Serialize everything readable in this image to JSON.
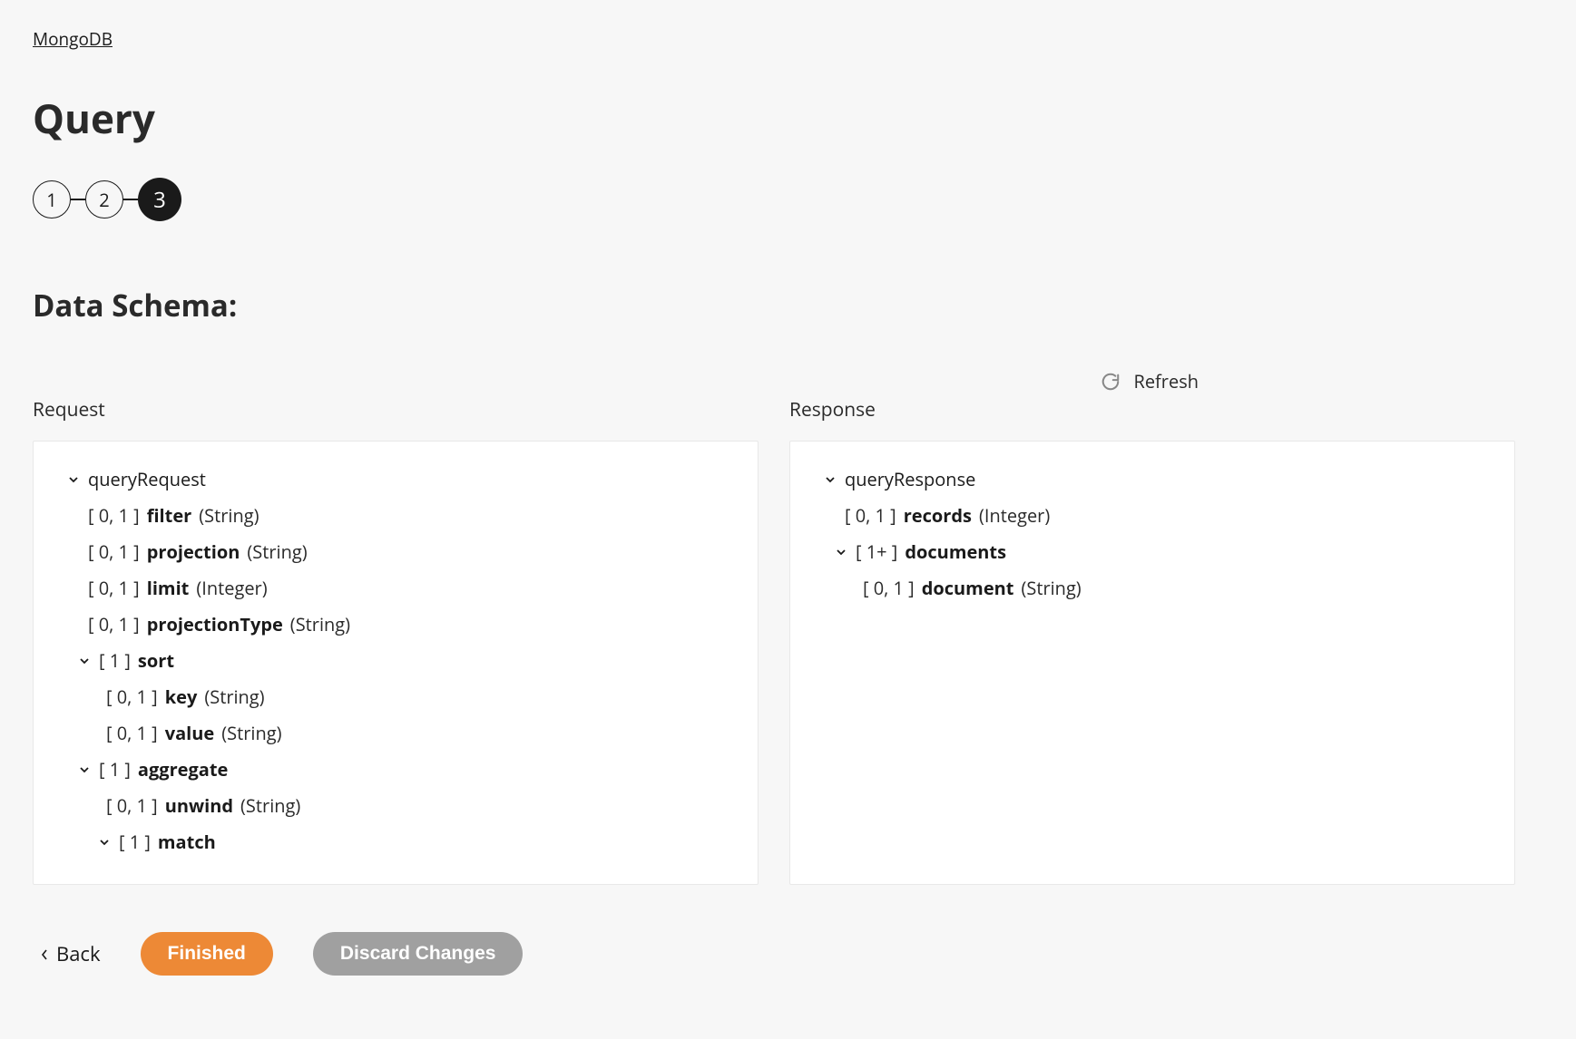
{
  "breadcrumb": {
    "root": "MongoDB"
  },
  "page_title": "Query",
  "steps": [
    "1",
    "2",
    "3"
  ],
  "active_step_index": 2,
  "section_title": "Data Schema:",
  "refresh_label": "Refresh",
  "request": {
    "label": "Request",
    "root": "queryRequest",
    "fields": {
      "filter": {
        "card": "[ 0, 1 ]",
        "name": "filter",
        "type": "(String)"
      },
      "projection": {
        "card": "[ 0, 1 ]",
        "name": "projection",
        "type": "(String)"
      },
      "limit": {
        "card": "[ 0, 1 ]",
        "name": "limit",
        "type": "(Integer)"
      },
      "projectionType": {
        "card": "[ 0, 1 ]",
        "name": "projectionType",
        "type": "(String)"
      },
      "sort": {
        "card": "[ 1 ]",
        "name": "sort"
      },
      "sort_key": {
        "card": "[ 0, 1 ]",
        "name": "key",
        "type": "(String)"
      },
      "sort_value": {
        "card": "[ 0, 1 ]",
        "name": "value",
        "type": "(String)"
      },
      "aggregate": {
        "card": "[ 1 ]",
        "name": "aggregate"
      },
      "agg_unwind": {
        "card": "[ 0, 1 ]",
        "name": "unwind",
        "type": "(String)"
      },
      "agg_match": {
        "card": "[ 1 ]",
        "name": "match"
      }
    }
  },
  "response": {
    "label": "Response",
    "root": "queryResponse",
    "fields": {
      "records": {
        "card": "[ 0, 1 ]",
        "name": "records",
        "type": "(Integer)"
      },
      "documents": {
        "card": "[ 1+ ]",
        "name": "documents"
      },
      "document": {
        "card": "[ 0, 1 ]",
        "name": "document",
        "type": "(String)"
      }
    }
  },
  "actions": {
    "back": "Back",
    "finished": "Finished",
    "discard": "Discard Changes"
  }
}
